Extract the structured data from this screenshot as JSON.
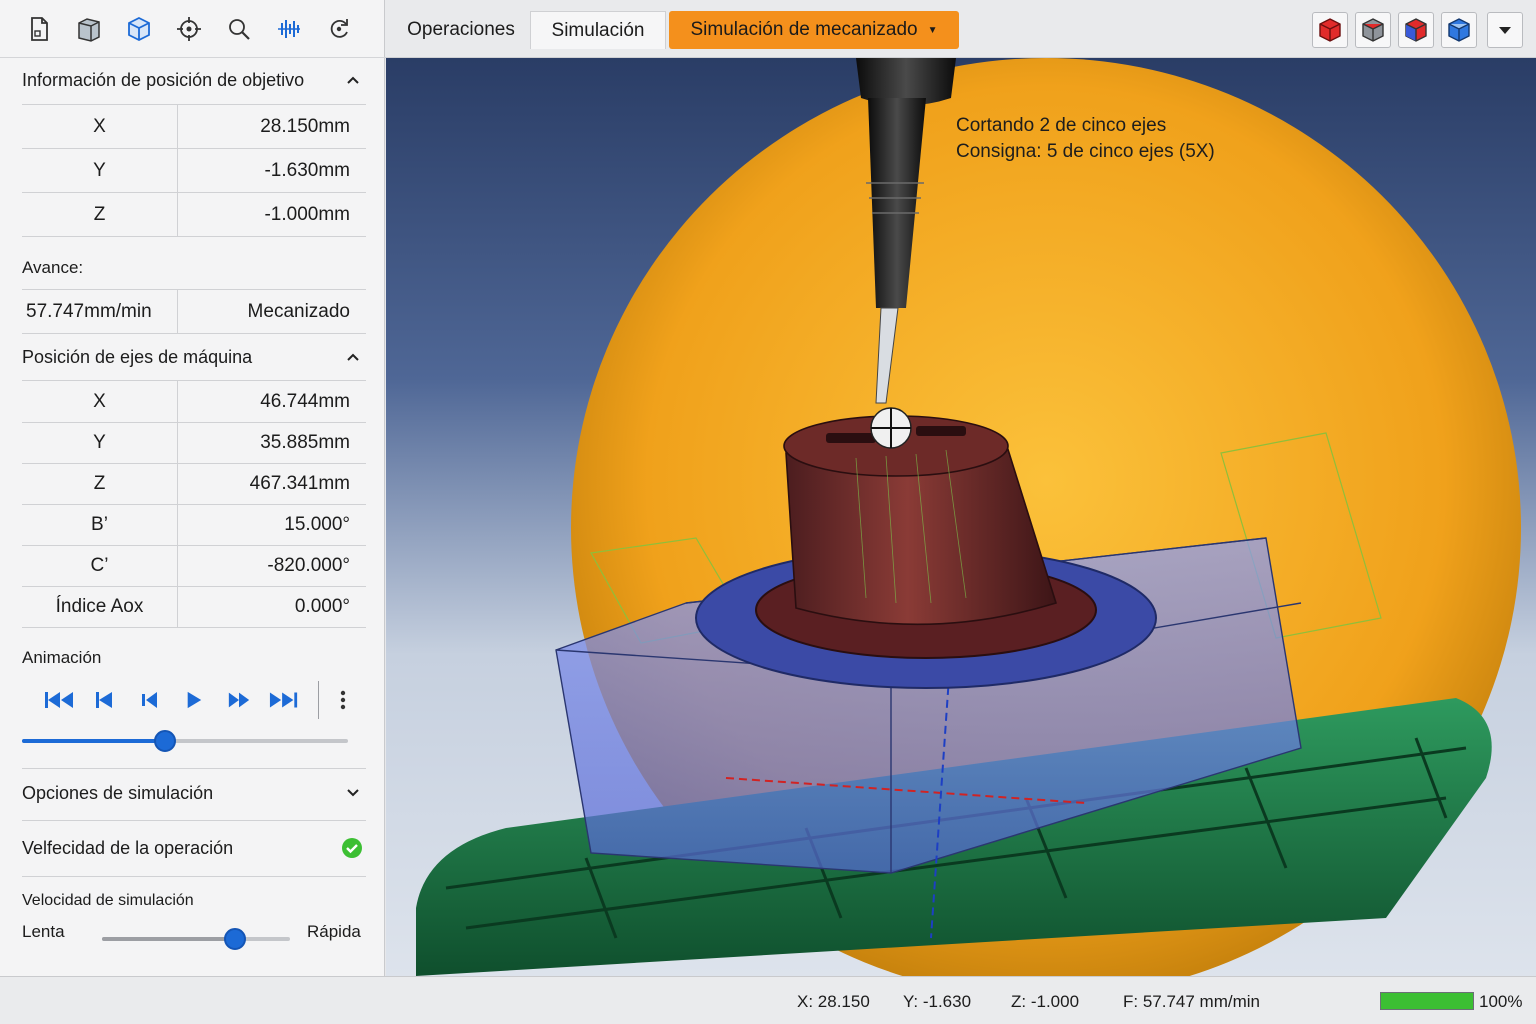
{
  "toolbar": {
    "icons": [
      "new-file-icon",
      "stock-icon",
      "cube-view-icon",
      "target-icon",
      "zoom-icon",
      "waveform-icon",
      "refresh-icon"
    ]
  },
  "target_position": {
    "title": "Información de posición de objetivo",
    "rows": [
      {
        "label": "X",
        "value": "28.150mm"
      },
      {
        "label": "Y",
        "value": "-1.630mm"
      },
      {
        "label": "Z",
        "value": "-1.000mm"
      }
    ]
  },
  "feed": {
    "label": "Avance:",
    "value": "57.747mm/min",
    "mode": "Mecanizado"
  },
  "machine_axes": {
    "title": "Posición de ejes de máquina",
    "rows": [
      {
        "label": "X",
        "value": "46.744mm"
      },
      {
        "label": "Y",
        "value": "35.885mm"
      },
      {
        "label": "Z",
        "value": "467.341mm"
      },
      {
        "label": "B’",
        "value": "15.000°"
      },
      {
        "label": "C’",
        "value": "-820.000°"
      },
      {
        "label": "Índice Aox",
        "value": "0.000°"
      }
    ]
  },
  "animation": {
    "title": "Animación",
    "progress_fraction": 0.44
  },
  "sim_options": {
    "title": "Opciones de simulación",
    "operation_speed_label": "Velfecidad de la operación"
  },
  "sim_speed": {
    "title": "Velocidad de simulación",
    "slow_label": "Lenta",
    "fast_label": "Rápida",
    "level_fraction": 0.71
  },
  "tabs": {
    "operations": "Operaciones",
    "simulation": "Simulación",
    "machining_sim": "Simulación de mecanizado"
  },
  "viewport": {
    "line1": "Cortando 2 de cinco ejes",
    "line2": "Consigna: 5 de cinco ejes (5X)"
  },
  "status": {
    "x": "X: 28.150",
    "y": "Y: -1.630",
    "z": "Z: -1.000",
    "f": "F: 57.747 mm/min",
    "progress_label": "100%",
    "progress_fraction": 1.0
  },
  "colors": {
    "accent": "#1c6ad6",
    "tab_active_orange": "#f4901c",
    "success_green": "#3cbf33"
  }
}
